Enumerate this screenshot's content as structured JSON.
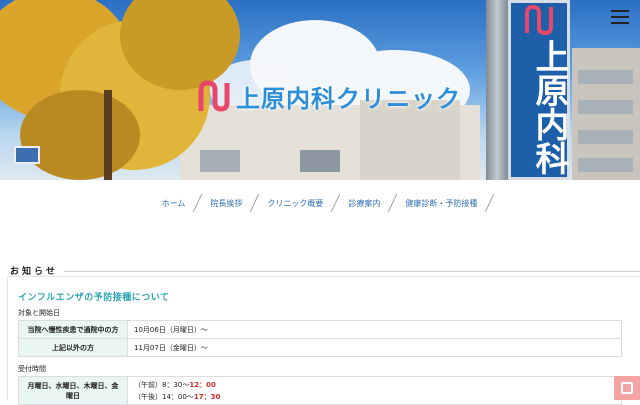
{
  "header": {
    "clinic_name": "上原内科クリニック",
    "sign_text": "上原内科",
    "menu_icon": "hamburger-icon"
  },
  "nav": {
    "items": [
      {
        "label": "ホーム"
      },
      {
        "label": "院長挨拶"
      },
      {
        "label": "クリニック概要"
      },
      {
        "label": "診療案内"
      },
      {
        "label": "健康診断・予防接種"
      }
    ]
  },
  "news": {
    "section_title": "お知らせ",
    "article_title": "インフルエンザの予防接種について",
    "targets_heading": "対象と開始日",
    "targets": [
      {
        "label": "当院へ慢性疾患で通院中の方",
        "value": "10月06日（月曜日）〜"
      },
      {
        "label": "上記以外の方",
        "value": "11月07日（金曜日）〜"
      }
    ],
    "hours_heading": "受付時間",
    "hours": {
      "label": "月曜日、水曜日、木曜日、金曜日",
      "am_prefix": "（午前）8：30〜",
      "am_end": "12：00",
      "pm_prefix": "（午後）14：00〜",
      "pm_end": "17：30"
    }
  },
  "colors": {
    "accent": "#2aa4b4",
    "nav_link": "#2f6fb4",
    "highlight": "#d62b2b",
    "table_header_bg": "#e9f6f3"
  }
}
